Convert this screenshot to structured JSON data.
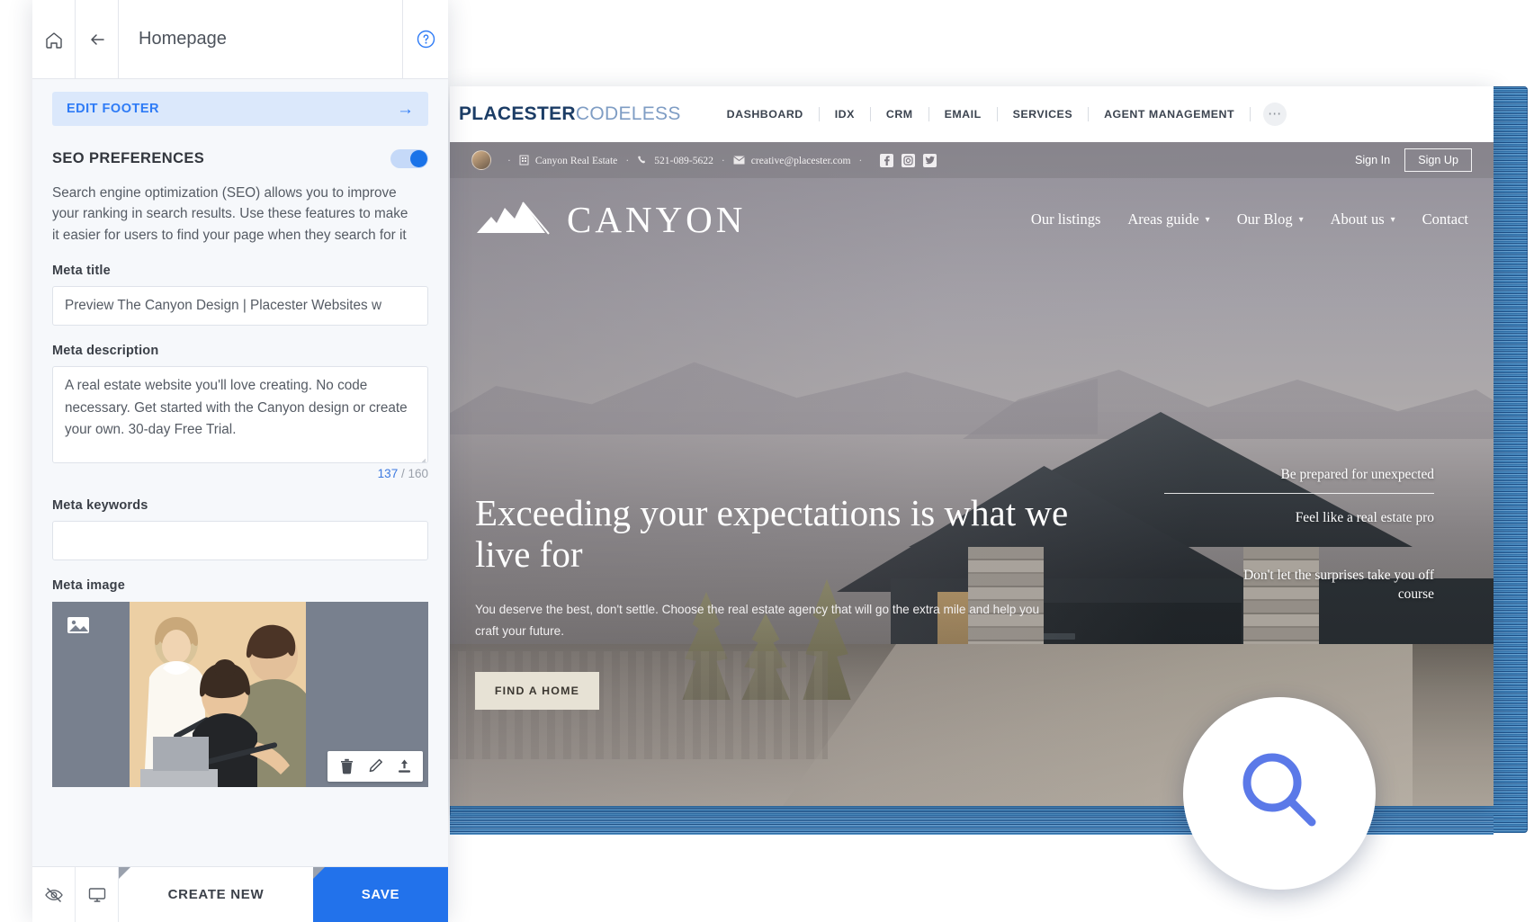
{
  "editor": {
    "toolbar": {
      "home_icon": "home-icon",
      "back_icon": "arrow-left-icon",
      "title": "Homepage",
      "help_icon": "help-circle-icon"
    },
    "edit_footer": {
      "label": "EDIT FOOTER",
      "arrow_icon": "arrow-right-icon"
    },
    "seo": {
      "section_title": "SEO PREFERENCES",
      "toggle_state": "on",
      "description": "Search engine optimization (SEO) allows you to improve your ranking in search results. Use these features to make it easier for users to find your page when they search for it",
      "meta_title_label": "Meta title",
      "meta_title_value": "Preview The Canyon Design | Placester Websites w",
      "meta_description_label": "Meta description",
      "meta_description_value": "A real estate website you'll love creating. No code necessary. Get started with the Canyon design or create your own. 30-day Free Trial.",
      "counter_current": "137",
      "counter_sep": " / ",
      "counter_max": "160",
      "meta_keywords_label": "Meta keywords",
      "meta_keywords_value": "",
      "meta_keywords_placeholder": "",
      "meta_image_label": "Meta image",
      "image_badge_icon": "image-icon",
      "image_actions": [
        {
          "icon": "trash-icon",
          "name": "delete-image-button"
        },
        {
          "icon": "pencil-icon",
          "name": "edit-image-button"
        },
        {
          "icon": "upload-icon",
          "name": "upload-image-button"
        }
      ]
    },
    "bottom_bar": {
      "preview_hidden_icon": "eye-off-icon",
      "desktop_icon": "monitor-icon",
      "create_new_label": "CREATE NEW",
      "save_label": "SAVE",
      "save_color": "#2272eb"
    }
  },
  "preview": {
    "app_nav": {
      "brand_bold": "PLACESTER",
      "brand_light": "CODELESS",
      "items": [
        "DASHBOARD",
        "IDX",
        "CRM",
        "EMAIL",
        "SERVICES",
        "AGENT MANAGEMENT"
      ],
      "more_icon": "ellipsis-icon"
    },
    "site_utility_bar": {
      "avatar_icon": "avatar",
      "company_icon": "building-icon",
      "company": "Canyon Real Estate",
      "phone_icon": "phone-icon",
      "phone": "521-089-5622",
      "email_icon": "envelope-icon",
      "email": "creative@placester.com",
      "socials": [
        "facebook-icon",
        "instagram-icon",
        "twitter-icon"
      ],
      "sign_in": "Sign In",
      "sign_up": "Sign Up"
    },
    "site_header": {
      "logo_icon": "mountain-logo-icon",
      "logo_text": "CANYON",
      "menu": [
        {
          "label": "Our listings",
          "caret": false
        },
        {
          "label": "Areas guide",
          "caret": true
        },
        {
          "label": "Our Blog",
          "caret": true
        },
        {
          "label": "About us",
          "caret": true
        },
        {
          "label": "Contact",
          "caret": false
        }
      ]
    },
    "hero": {
      "headline": "Exceeding your expectations is what we live for",
      "body": "You deserve the best, don't settle. Choose the real estate agency that will go the extra mile and help you craft your future.",
      "cta_label": "FIND A HOME",
      "annotations": [
        "Be prepared for unexpected",
        "Feel like a real estate pro",
        "Don't let the surprises take you off course"
      ]
    },
    "magnifier_icon": "search-icon",
    "magnifier_color": "#5b79e8"
  }
}
